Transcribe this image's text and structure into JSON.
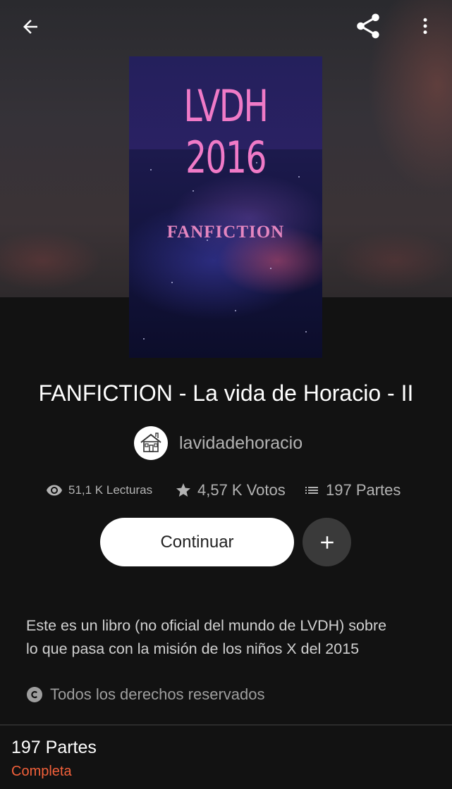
{
  "cover": {
    "title": "LVDH 2016",
    "subtitle": "FANFICTION"
  },
  "story": {
    "title": "FANFICTION - La vida de Horacio - II",
    "author": "lavidadehoracio"
  },
  "stats": {
    "reads": "51,1 K Lecturas",
    "votes": "4,57 K Votos",
    "parts": "197 Partes"
  },
  "actions": {
    "continue_label": "Continuar",
    "add_label": "+"
  },
  "description": {
    "line1": "Este es un libro (no oficial del mundo de LVDH) sobre",
    "line2": "lo que pasa con la misión de los niños X del 2015"
  },
  "copyright": {
    "text": "Todos los derechos reservados"
  },
  "parts_section": {
    "count": "197 Partes",
    "status": "Completa"
  },
  "colors": {
    "background": "#121212",
    "status_accent": "#f2603a",
    "cover_title": "#f07ac7"
  },
  "icons": {
    "back": "arrow-left-icon",
    "share": "share-icon",
    "more": "more-vertical-icon",
    "reads": "eye-icon",
    "votes": "star-icon",
    "parts": "list-icon",
    "add": "plus-icon",
    "copyright": "copyright-icon"
  }
}
